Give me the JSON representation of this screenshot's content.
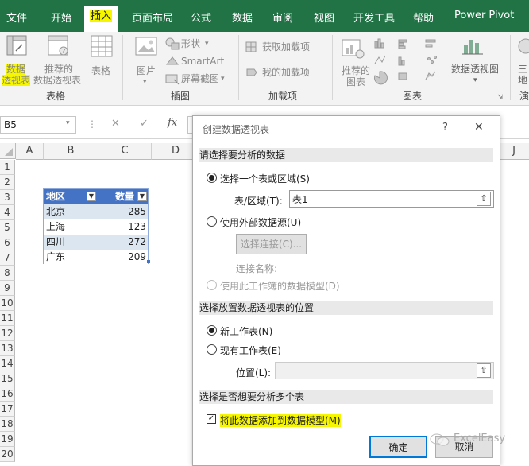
{
  "tabs": [
    "文件",
    "开始",
    "插入",
    "页面布局",
    "公式",
    "数据",
    "审阅",
    "视图",
    "开发工具",
    "帮助",
    "Power Pivot"
  ],
  "ribbon": {
    "pivot_line1": "数据",
    "pivot_line2": "透视表",
    "rec_pivot_line1": "推荐的",
    "rec_pivot_line2": "数据透视表",
    "table": "表格",
    "picture": "图片",
    "shapes": "形状",
    "smartart": "SmartArt",
    "screenshot": "屏幕截图",
    "get_addins": "获取加载项",
    "my_addins": "我的加载项",
    "rec_charts_line1": "推荐的",
    "rec_charts_line2": "图表",
    "pivotchart": "数据透视图",
    "three_d_line1": "三",
    "three_d_line2": "地",
    "group_table": "表格",
    "group_illustrations": "插图",
    "group_addins": "加载项",
    "group_charts": "图表",
    "group_tours": "演"
  },
  "formula": {
    "namebox": "B5",
    "cancel": "✕",
    "enter": "✓",
    "fx": "fx"
  },
  "grid": {
    "columns": [
      "A",
      "B",
      "C",
      "D",
      "J"
    ],
    "rows": [
      "1",
      "2",
      "3",
      "4",
      "5",
      "6",
      "7",
      "8",
      "9",
      "10",
      "11",
      "12",
      "13",
      "14",
      "15",
      "16",
      "17",
      "18",
      "19",
      "20"
    ]
  },
  "table": {
    "headers": [
      "地区",
      "数量"
    ],
    "rows": [
      [
        "北京",
        "285"
      ],
      [
        "上海",
        "123"
      ],
      [
        "四川",
        "272"
      ],
      [
        "广东",
        "209"
      ]
    ]
  },
  "dialog": {
    "title": "创建数据透视表",
    "help": "?",
    "close": "✕",
    "section1": "请选择要分析的数据",
    "opt_range": "选择一个表或区域(S)",
    "range_label": "表/区域(T):",
    "range_value": "表1",
    "opt_external": "使用外部数据源(U)",
    "choose_conn": "选择连接(C)...",
    "conn_name": "连接名称:",
    "opt_model": "使用此工作簿的数据模型(D)",
    "section2": "选择放置数据透视表的位置",
    "opt_new": "新工作表(N)",
    "opt_existing": "现有工作表(E)",
    "location_label": "位置(L):",
    "location_value": "",
    "section3": "选择是否想要分析多个表",
    "add_model": "将此数据添加到数据模型(M)",
    "ok": "确定",
    "cancel": "取消"
  },
  "watermark": "ExcelEasy",
  "colors": {
    "excel_green": "#217346",
    "highlight": "#f6f600",
    "table_header": "#4472c4",
    "table_band": "#dce6f1"
  }
}
